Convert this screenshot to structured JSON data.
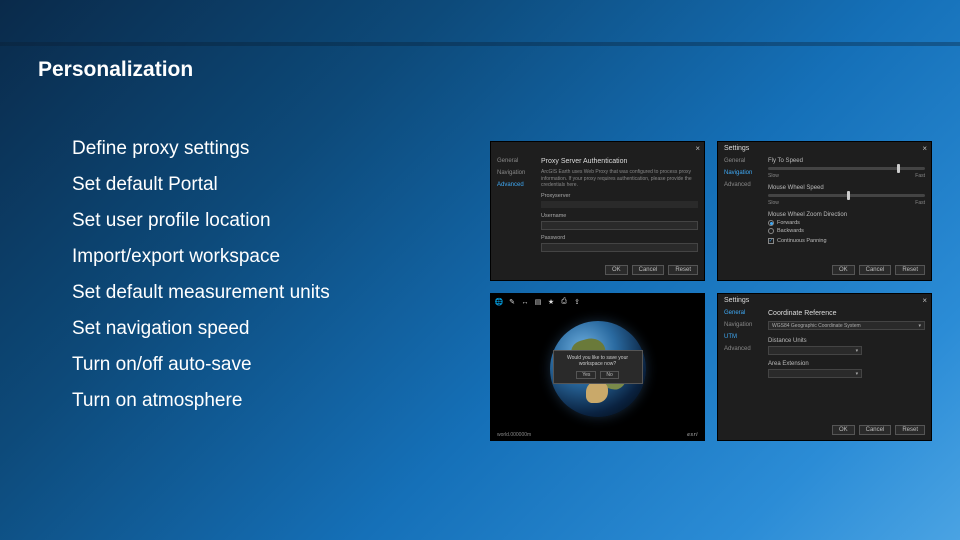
{
  "title": "Personalization",
  "bullets": [
    "Define proxy settings",
    "Set default Portal",
    "Set user profile location",
    "Import/export workspace",
    "Set default measurement units",
    "Set navigation speed",
    "Turn on/off auto-save",
    "Turn on atmosphere"
  ],
  "panels": {
    "proxy": {
      "close": "×",
      "nav": {
        "general": "General",
        "navigation": "Navigation",
        "advanced": "Advanced"
      },
      "heading": "Proxy Server Authentication",
      "desc": "ArcGIS Earth uses Web Proxy that was configured to process proxy information. If your proxy requires authentication, please provide the credentials here.",
      "proxyserver_label": "Proxyserver",
      "username_label": "Username",
      "password_label": "Password",
      "ok_label": "OK",
      "cancel_label": "Cancel",
      "reset_label": "Reset"
    },
    "nav": {
      "title": "Settings",
      "close": "×",
      "tabs": {
        "general": "General",
        "navigation": "Navigation",
        "advanced": "Advanced"
      },
      "flyto_label": "Fly To Speed",
      "slow": "Slow",
      "fast": "Fast",
      "wheel_label": "Mouse Wheel Speed",
      "zoomdir_label": "Mouse Wheel Zoom Direction",
      "opt_forward": "Forwards",
      "opt_backward": "Backwards",
      "continuous_panning": "Continuous Panning",
      "ok_label": "OK",
      "cancel_label": "Cancel",
      "reset_label": "Reset"
    },
    "viewer": {
      "popup_text": "Would you like to save your workspace now?",
      "yes": "Yes",
      "no": "No",
      "footer_left": "world.000000m",
      "esri": "esri"
    },
    "coord": {
      "title": "Settings",
      "close": "×",
      "tabs": {
        "general": "General",
        "navigation": "Navigation",
        "utm": "UTM",
        "advanced": "Advanced"
      },
      "heading": "Coordinate Reference",
      "select_value": "WGS84 Geographic Coordinate System",
      "distance_label": "Distance Units",
      "area_label": "Area Extension",
      "ok_label": "OK",
      "cancel_label": "Cancel",
      "reset_label": "Reset"
    }
  }
}
